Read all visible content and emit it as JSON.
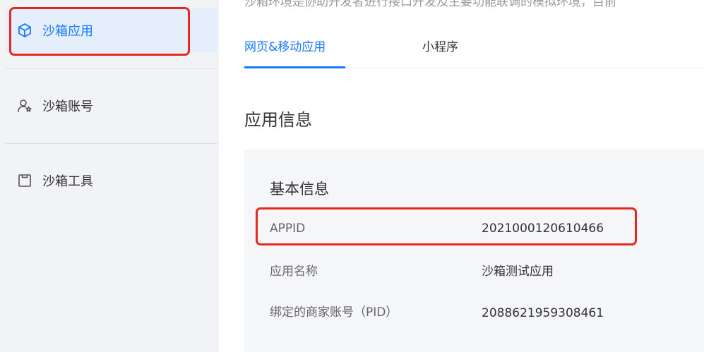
{
  "sidebar": {
    "items": [
      {
        "label": "沙箱应用",
        "icon": "cube-icon",
        "active": true
      },
      {
        "label": "沙箱账号",
        "icon": "user-star-icon",
        "active": false
      },
      {
        "label": "沙箱工具",
        "icon": "toolbox-icon",
        "active": false
      }
    ]
  },
  "main": {
    "intro": "沙箱环境是协助开发者进行接口开发及主要功能联调的模拟环境，目前",
    "tabs": [
      {
        "label": "网页&移动应用",
        "active": true
      },
      {
        "label": "小程序",
        "active": false
      }
    ],
    "section_title": "应用信息",
    "card": {
      "title": "基本信息",
      "rows": [
        {
          "label": "APPID",
          "value": "2021000120610466"
        },
        {
          "label": "应用名称",
          "value": "沙箱测试应用"
        },
        {
          "label": "绑定的商家账号（PID）",
          "value": "2088621959308461"
        }
      ]
    }
  },
  "colors": {
    "accent": "#1677ff",
    "highlight": "#e8281e",
    "active_bg": "#e5effc"
  }
}
